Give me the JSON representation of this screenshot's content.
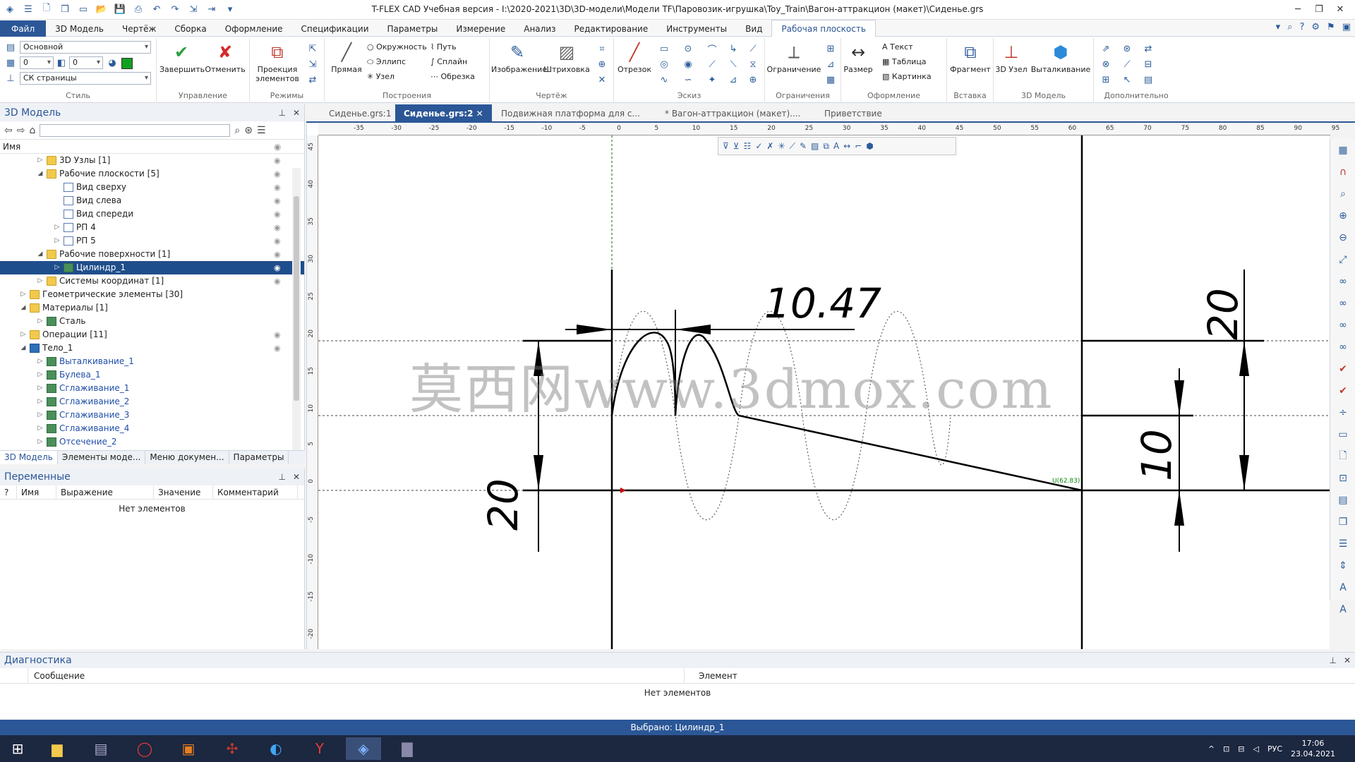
{
  "window": {
    "title": "T-FLEX CAD Учебная версия - I:\\2020-2021\\3D\\3D-модели\\Модели TF\\Паровозик-игрушка\\Toy_Train\\Вагон-аттракцион (макет)\\Сиденье.grs"
  },
  "menu": {
    "items": [
      "Файл",
      "3D Модель",
      "Чертёж",
      "Сборка",
      "Оформление",
      "Спецификации",
      "Параметры",
      "Измерение",
      "Анализ",
      "Редактирование",
      "Инструменты",
      "Вид",
      "Рабочая плоскость"
    ],
    "active": "Рабочая плоскость"
  },
  "ribbon": {
    "style": {
      "label": "Стиль",
      "layer": "Основной",
      "num1": "0",
      "num2": "0",
      "cs": "СК страницы"
    },
    "manage": {
      "label": "Управление",
      "finish": "Завершить",
      "cancel": "Отменить"
    },
    "modes": {
      "label": "Режимы",
      "projection": "Проекция элементов"
    },
    "build": {
      "label": "Построения",
      "line": "Прямая",
      "circle": "Окружность",
      "ellipse": "Эллипс",
      "node": "Узел",
      "path": "Путь",
      "spline": "Сплайн",
      "trim": "Обрезка"
    },
    "drawing": {
      "label": "Чертёж",
      "image": "Изображение",
      "hatch": "Штриховка"
    },
    "sketch": {
      "label": "Эскиз",
      "segment": "Отрезок"
    },
    "constraints": {
      "label": "Ограничения",
      "constraint": "Ограничение"
    },
    "design": {
      "label": "Оформление",
      "size": "Размер",
      "text": "Текст",
      "table": "Таблица",
      "picture": "Картинка"
    },
    "insert": {
      "label": "Вставка",
      "fragment": "Фрагмент"
    },
    "model3d": {
      "label": "3D Модель",
      "node3d": "3D Узел",
      "extrude": "Выталкивание"
    },
    "extra": {
      "label": "Дополнительно"
    }
  },
  "leftpanel": {
    "title": "3D Модель",
    "column": "Имя",
    "tree": [
      {
        "label": "3D Узлы [1]",
        "level": 1,
        "tw": "▷",
        "icon": "fold",
        "eye": true
      },
      {
        "label": "Рабочие плоскости [5]",
        "level": 1,
        "tw": "◢",
        "icon": "fold",
        "eye": true
      },
      {
        "label": "Вид сверху",
        "level": 2,
        "tw": "",
        "icon": "plane",
        "eye": true
      },
      {
        "label": "Вид слева",
        "level": 2,
        "tw": "",
        "icon": "plane",
        "eye": true
      },
      {
        "label": "Вид спереди",
        "level": 2,
        "tw": "",
        "icon": "plane",
        "eye": true
      },
      {
        "label": "РП 4",
        "level": 2,
        "tw": "▷",
        "icon": "plane",
        "eye": true
      },
      {
        "label": "РП 5",
        "level": 2,
        "tw": "▷",
        "icon": "plane",
        "eye": true
      },
      {
        "label": "Рабочие поверхности [1]",
        "level": 1,
        "tw": "◢",
        "icon": "fold",
        "eye": true
      },
      {
        "label": "Цилиндр_1",
        "level": 2,
        "tw": "▷",
        "icon": "op",
        "eye": true,
        "sel": true
      },
      {
        "label": "Системы координат [1]",
        "level": 1,
        "tw": "▷",
        "icon": "fold",
        "eye": true
      },
      {
        "label": "Геометрические элементы [30]",
        "level": 0,
        "tw": "▷",
        "icon": "fold",
        "eye": false
      },
      {
        "label": "Материалы [1]",
        "level": 0,
        "tw": "◢",
        "icon": "fold",
        "eye": false
      },
      {
        "label": "Сталь",
        "level": 1,
        "tw": "▷",
        "icon": "op",
        "eye": false
      },
      {
        "label": "Операции [11]",
        "level": 0,
        "tw": "▷",
        "icon": "fold",
        "eye": true
      },
      {
        "label": "Тело_1",
        "level": 0,
        "tw": "◢",
        "icon": "body3d",
        "eye": true
      },
      {
        "label": "Выталкивание_1",
        "level": 1,
        "tw": "▷",
        "icon": "op",
        "eye": false,
        "blue": true
      },
      {
        "label": "Булева_1",
        "level": 1,
        "tw": "▷",
        "icon": "op",
        "eye": false,
        "blue": true
      },
      {
        "label": "Сглаживание_1",
        "level": 1,
        "tw": "▷",
        "icon": "op",
        "eye": false,
        "blue": true
      },
      {
        "label": "Сглаживание_2",
        "level": 1,
        "tw": "▷",
        "icon": "op",
        "eye": false,
        "blue": true
      },
      {
        "label": "Сглаживание_3",
        "level": 1,
        "tw": "▷",
        "icon": "op",
        "eye": false,
        "blue": true
      },
      {
        "label": "Сглаживание_4",
        "level": 1,
        "tw": "▷",
        "icon": "op",
        "eye": false,
        "blue": true
      },
      {
        "label": "Отсечение_2",
        "level": 1,
        "tw": "▷",
        "icon": "op",
        "eye": false,
        "blue": true
      }
    ],
    "tabs": [
      "3D Модель",
      "Элементы моде...",
      "Меню докумен...",
      "Параметры"
    ]
  },
  "variables": {
    "title": "Переменные",
    "cols": [
      "?",
      "Имя",
      "Выражение",
      "Значение",
      "Комментарий"
    ],
    "empty": "Нет элементов"
  },
  "doctabs": [
    "Сиденье.grs:1",
    "Сиденье.grs:2",
    "Подвижная платформа для с...",
    "* Вагон-аттракцион (макет)....",
    "Приветствие"
  ],
  "ruler": {
    "h": [
      "-35",
      "-30",
      "-25",
      "-20",
      "-15",
      "-10",
      "-5",
      "0",
      "5",
      "10",
      "15",
      "20",
      "25",
      "30",
      "35",
      "40",
      "45",
      "50",
      "55",
      "60",
      "65",
      "70",
      "75",
      "80",
      "85",
      "90",
      "95"
    ],
    "v": [
      "45",
      "40",
      "35",
      "30",
      "25",
      "20",
      "15",
      "10",
      "5",
      "0",
      "-5",
      "-10",
      "-15",
      "-20"
    ]
  },
  "drawing": {
    "dim_top": "10.47",
    "dim_left": "20",
    "dim_right_top": "20",
    "dim_right_mid": "10",
    "point_label": "U(62.83)",
    "watermark": "莫西网www.3dmox.com"
  },
  "diagnostics": {
    "title": "Диагностика",
    "cols": [
      "Сообщение",
      "Элемент"
    ],
    "empty": "Нет элементов"
  },
  "status": {
    "text": "Выбрано: Цилиндр_1"
  },
  "taskbar": {
    "lang": "РУС",
    "time": "17:06",
    "date": "23.04.2021"
  }
}
